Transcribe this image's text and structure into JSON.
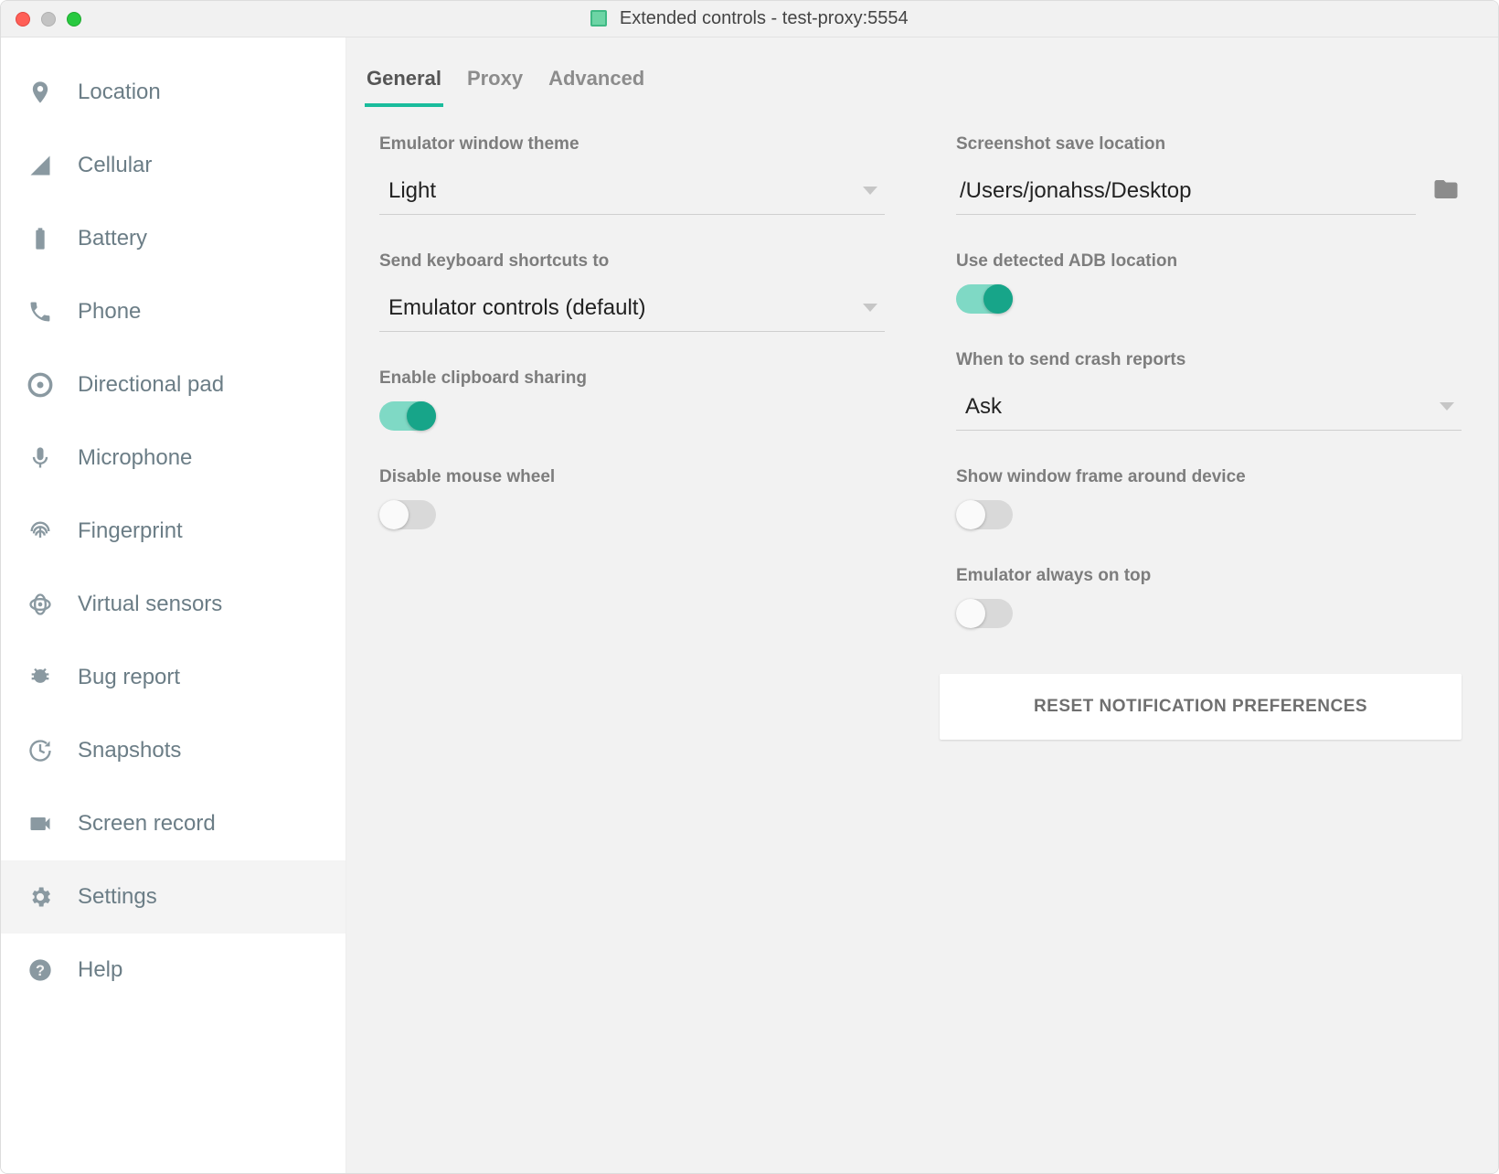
{
  "window": {
    "title": "Extended controls - test-proxy:5554"
  },
  "sidebar": {
    "items": [
      {
        "id": "location",
        "label": "Location"
      },
      {
        "id": "cellular",
        "label": "Cellular"
      },
      {
        "id": "battery",
        "label": "Battery"
      },
      {
        "id": "phone",
        "label": "Phone"
      },
      {
        "id": "directional-pad",
        "label": "Directional pad"
      },
      {
        "id": "microphone",
        "label": "Microphone"
      },
      {
        "id": "fingerprint",
        "label": "Fingerprint"
      },
      {
        "id": "virtual-sensors",
        "label": "Virtual sensors"
      },
      {
        "id": "bug-report",
        "label": "Bug report"
      },
      {
        "id": "snapshots",
        "label": "Snapshots"
      },
      {
        "id": "screen-record",
        "label": "Screen record"
      },
      {
        "id": "settings",
        "label": "Settings",
        "active": true
      },
      {
        "id": "help",
        "label": "Help"
      }
    ]
  },
  "tabs": [
    {
      "id": "general",
      "label": "General",
      "active": true
    },
    {
      "id": "proxy",
      "label": "Proxy"
    },
    {
      "id": "advanced",
      "label": "Advanced"
    }
  ],
  "settings": {
    "theme": {
      "label": "Emulator window theme",
      "value": "Light"
    },
    "shortcuts": {
      "label": "Send keyboard shortcuts to",
      "value": "Emulator controls (default)"
    },
    "clipboard": {
      "label": "Enable clipboard sharing",
      "on": true
    },
    "mousewheel": {
      "label": "Disable mouse wheel",
      "on": false
    },
    "screenshot": {
      "label": "Screenshot save location",
      "value": "/Users/jonahss/Desktop"
    },
    "adb": {
      "label": "Use detected ADB location",
      "on": true
    },
    "crash": {
      "label": "When to send crash reports",
      "value": "Ask"
    },
    "window_frame": {
      "label": "Show window frame around device",
      "on": false
    },
    "always_on_top": {
      "label": "Emulator always on top",
      "on": false
    },
    "reset_button": "RESET NOTIFICATION PREFERENCES"
  }
}
